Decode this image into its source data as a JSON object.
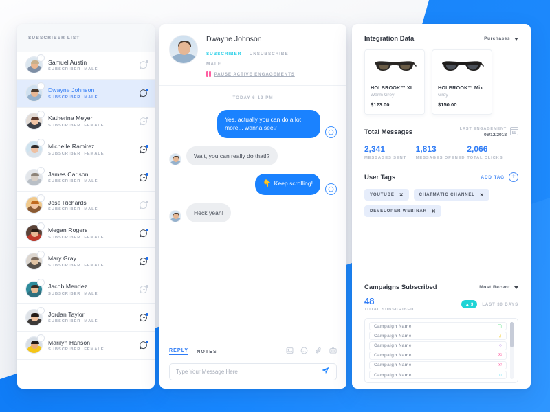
{
  "theme": {
    "accent_blue": "#1a82ff",
    "cyan": "#2ed0e8",
    "pink": "#ff5fa2",
    "teal_pill": "#1fd4d6",
    "muted": "#b6bcc7"
  },
  "subscriber_panel": {
    "header": "SUBSCRIBER LIST",
    "items": [
      {
        "name": "Samuel Austin",
        "role": "SUBSCRIBER",
        "gender": "MALE",
        "unread": false,
        "active": false,
        "skin": "#e8b68f",
        "hair": "#c9b08b",
        "shirt": "#7e8fa5",
        "sky": "#dbe6ef"
      },
      {
        "name": "Dwayne Johnson",
        "role": "SUBSCRIBER",
        "gender": "MALE",
        "unread": true,
        "active": true,
        "skin": "#e6b795",
        "hair": "#4a3a2e",
        "shirt": "#95b1cc",
        "sky": "#cfe0ef"
      },
      {
        "name": "Katherine Meyer",
        "role": "SUBSCRIBER",
        "gender": "FEMALE",
        "unread": false,
        "active": false,
        "skin": "#f0c3a4",
        "hair": "#5b3a2c",
        "shirt": "#3c3f47",
        "sky": "#e3dcd6"
      },
      {
        "name": "Michelle Ramirez",
        "role": "SUBSCRIBER",
        "gender": "FEMALE",
        "unread": true,
        "active": false,
        "skin": "#eec0a2",
        "hair": "#2f2a28",
        "shirt": "#d9e2ea",
        "sky": "#cfe3ef"
      },
      {
        "name": "James Carlson",
        "role": "SUBSCRIBER",
        "gender": "MALE",
        "unread": true,
        "active": false,
        "skin": "#d8cfc6",
        "hair": "#8d8479",
        "shirt": "#b9bfc6",
        "sky": "#e3e6ea"
      },
      {
        "name": "Jose Richards",
        "role": "SUBSCRIBER",
        "gender": "MALE",
        "unread": false,
        "active": false,
        "skin": "#f1c5a3",
        "hair": "#c06a1f",
        "shirt": "#8a5a33",
        "sky": "#f0c98d"
      },
      {
        "name": "Megan Rogers",
        "role": "SUBSCRIBER",
        "gender": "FEMALE",
        "unread": true,
        "active": false,
        "skin": "#e8b794",
        "hair": "#2b1d16",
        "shirt": "#c0392b",
        "sky": "#5b4338"
      },
      {
        "name": "Mary Gray",
        "role": "SUBSCRIBER",
        "gender": "FEMALE",
        "unread": true,
        "active": false,
        "skin": "#e0c3a4",
        "hair": "#7a6a5c",
        "shirt": "#55504b",
        "sky": "#dcd6cf"
      },
      {
        "name": "Jacob Mendez",
        "role": "SUBSCRIBER",
        "gender": "MALE",
        "unread": false,
        "active": false,
        "skin": "#e9bb93",
        "hair": "#3a2c22",
        "shirt": "#2f6f7e",
        "sky": "#2e8b9b"
      },
      {
        "name": "Jordan Taylor",
        "role": "SUBSCRIBER",
        "gender": "MALE",
        "unread": true,
        "active": false,
        "skin": "#efc19e",
        "hair": "#241c18",
        "shirt": "#3d3a38",
        "sky": "#dfe3e8"
      },
      {
        "name": "Marilyn Hanson",
        "role": "SUBSCRIBER",
        "gender": "FEMALE",
        "unread": true,
        "active": false,
        "skin": "#e5a978",
        "hair": "#221a16",
        "shirt": "#f4c518",
        "sky": "#d7dee6"
      }
    ]
  },
  "conversation": {
    "contact_name": "Dwayne Johnson",
    "status_tag": "SUBSCRIBER",
    "unsubscribe_label": "UNSUBSCRIBE",
    "gender": "MALE",
    "pause_label": "PAUSE ACTIVE ENGAGEMENTS",
    "timestamp": "TODAY 6:12 PM",
    "messages": [
      {
        "from": "out",
        "text": "Yes, actually you can do a lot more... wanna see?",
        "emoji": ""
      },
      {
        "from": "in",
        "text": "Wait, you can really do that!?",
        "emoji": ""
      },
      {
        "from": "out",
        "text": "Keep scrolling!",
        "emoji": "👇"
      },
      {
        "from": "in",
        "text": "Heck yeah!",
        "emoji": ""
      }
    ],
    "tab_reply": "REPLY",
    "tab_notes": "NOTES",
    "input_placeholder": "Type Your Message Here",
    "input_value": ""
  },
  "details": {
    "integration": {
      "title": "Integration Data",
      "filter": "Purchases",
      "products": [
        {
          "name": "HOLBROOK™ XL",
          "color": "Warm Grey",
          "price": "$123.00",
          "lens": "#6a5c46",
          "frame": "#2a2724"
        },
        {
          "name": "HOLBROOK™ Mix",
          "color": "Grey",
          "price": "$150.00",
          "lens": "#4a4f57",
          "frame": "#1f1d1c"
        }
      ]
    },
    "messages": {
      "title": "Total Messages",
      "last_engagement_label": "LAST ENGAGEMENT",
      "last_engagement_date": "06/12/2018",
      "stats": [
        {
          "value": "2,341",
          "label": "MESSAGES SENT"
        },
        {
          "value": "1,813",
          "label": "MESSAGES OPENED"
        },
        {
          "value": "2,066",
          "label": "TOTAL CLICKS"
        }
      ]
    },
    "user_tags": {
      "title": "User Tags",
      "add_label": "ADD TAG",
      "tags": [
        "YOUTUBE",
        "CHATMATIC CHANNEL",
        "DEVELOPER WEBINAR"
      ]
    },
    "campaigns": {
      "title": "Campaigns Subscribed",
      "sort": "Most Recent",
      "total": "48",
      "total_label": "TOTAL SUBSCRIBED",
      "delta": "3",
      "period_label": "LAST 30 DAYS",
      "items": [
        {
          "name": "Campaign Name",
          "icon": "robot-icon",
          "glyph": "▢",
          "color": "#4cdc7a"
        },
        {
          "name": "Campaign Name",
          "icon": "key-icon",
          "glyph": "⚷",
          "color": "#f5d44d"
        },
        {
          "name": "Campaign Name",
          "icon": "chat-bubble-icon",
          "glyph": "○",
          "color": "#a96ae0"
        },
        {
          "name": "Campaign Name",
          "icon": "megaphone-icon",
          "glyph": "✉",
          "color": "#ff5fa2"
        },
        {
          "name": "Campaign Name",
          "icon": "megaphone-icon",
          "glyph": "✉",
          "color": "#ff5fa2"
        },
        {
          "name": "Campaign Name",
          "icon": "bell-icon",
          "glyph": "○",
          "color": "#48d6ef"
        }
      ]
    }
  }
}
